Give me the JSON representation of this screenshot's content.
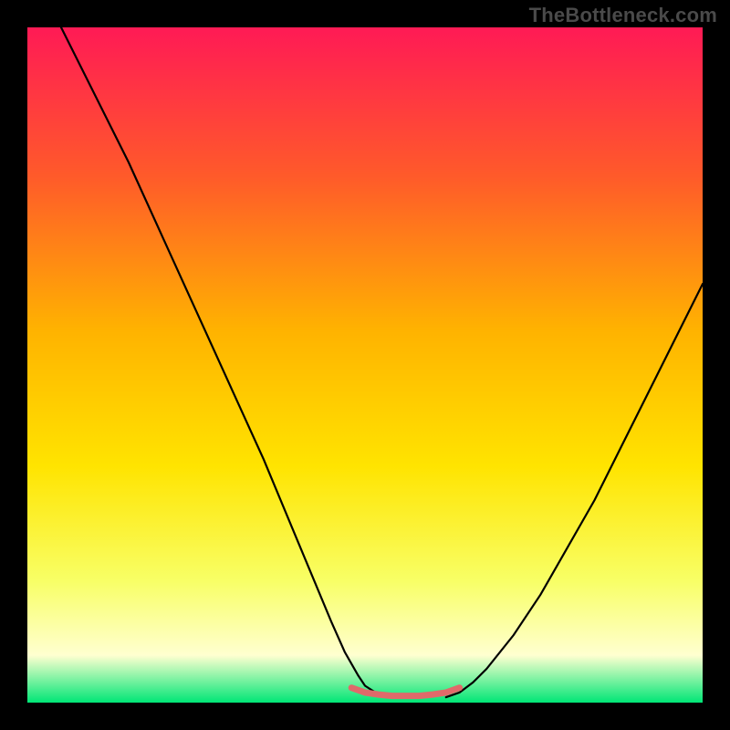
{
  "watermark": "TheBottleneck.com",
  "colors": {
    "frame_black": "#000000",
    "gradient_top": "#ff1a55",
    "gradient_upper_mid": "#ff5a2a",
    "gradient_mid": "#ffb300",
    "gradient_lower_mid": "#ffe400",
    "gradient_low": "#f8ff66",
    "gradient_pale": "#ffffd0",
    "gradient_bottom": "#00e676",
    "curve_color": "#000000",
    "bottom_marker": "#e06a6a"
  },
  "chart_data": {
    "type": "line",
    "title": "",
    "xlabel": "",
    "ylabel": "",
    "xlim": [
      0,
      100
    ],
    "ylim": [
      0,
      100
    ],
    "series": [
      {
        "name": "left-branch",
        "x": [
          5,
          10,
          15,
          20,
          25,
          30,
          35,
          40,
          45,
          47,
          49,
          50,
          52,
          54
        ],
        "y": [
          100,
          90,
          80,
          69,
          58,
          47,
          36,
          24,
          12,
          7.5,
          4,
          2.5,
          1.2,
          0.8
        ]
      },
      {
        "name": "right-branch",
        "x": [
          62,
          64,
          66,
          68,
          72,
          76,
          80,
          84,
          88,
          92,
          96,
          100
        ],
        "y": [
          0.8,
          1.5,
          3,
          5,
          10,
          16,
          23,
          30,
          38,
          46,
          54,
          62
        ]
      },
      {
        "name": "floor-segment",
        "x": [
          48,
          50,
          52,
          54,
          56,
          58,
          60,
          62,
          64
        ],
        "y": [
          2.2,
          1.5,
          1.2,
          1.0,
          1.0,
          1.0,
          1.2,
          1.5,
          2.2
        ]
      }
    ],
    "annotations": []
  }
}
